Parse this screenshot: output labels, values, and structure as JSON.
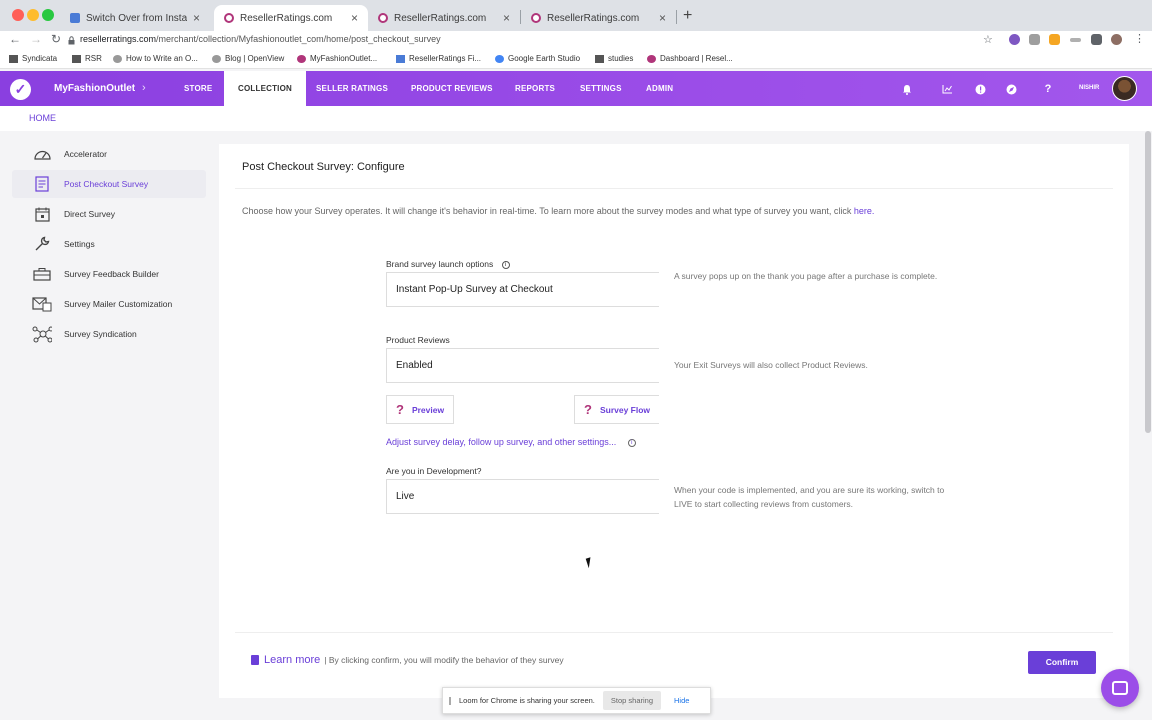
{
  "browser": {
    "tabs": [
      {
        "title": "Switch Over from Instant Surv..."
      },
      {
        "title": "ResellerRatings.com"
      },
      {
        "title": "ResellerRatings.com"
      },
      {
        "title": "ResellerRatings.com"
      }
    ],
    "url_host": "resellerratings.com",
    "url_path": "/merchant/collection/Myfashionoutlet_com/home/post_checkout_survey",
    "bookmarks": [
      "Syndicata",
      "RSR",
      "How to Write an O...",
      "Blog | OpenView",
      "MyFashionOutlet...",
      "ResellerRatings Fi...",
      "Google Earth Studio",
      "studies",
      "Dashboard | Resel..."
    ]
  },
  "header": {
    "brand": "MyFashionOutlet",
    "nav": [
      "STORE",
      "COLLECTION",
      "SELLER RATINGS",
      "PRODUCT REVIEWS",
      "REPORTS",
      "SETTINGS",
      "ADMIN"
    ],
    "user": "NISHIR"
  },
  "breadcrumb": "HOME",
  "sidebar": {
    "items": [
      {
        "label": "Accelerator",
        "icon": "gauge-icon"
      },
      {
        "label": "Post Checkout Survey",
        "icon": "document-icon"
      },
      {
        "label": "Direct Survey",
        "icon": "calendar-icon"
      },
      {
        "label": "Settings",
        "icon": "wrench-icon"
      },
      {
        "label": "Survey Feedback Builder",
        "icon": "toolbox-icon"
      },
      {
        "label": "Survey Mailer Customization",
        "icon": "mail-icon"
      },
      {
        "label": "Survey Syndication",
        "icon": "network-icon"
      }
    ]
  },
  "main": {
    "title": "Post Checkout Survey: Configure",
    "description": "Choose how your Survey operates. It will change it's behavior in real-time. To learn more about the survey modes and what type of survey you want, click",
    "description_link": "here.",
    "launch": {
      "label": "Brand survey launch options",
      "value": "Instant Pop-Up Survey at Checkout",
      "help": "A survey pops up on the thank you page after a purchase is complete."
    },
    "reviews": {
      "label": "Product Reviews",
      "value": "Enabled",
      "help": "Your Exit Surveys will also collect Product Reviews."
    },
    "preview_label": "Preview",
    "flow_label": "Survey Flow",
    "settings_link": "Adjust survey delay, follow up survey, and other settings...",
    "dev": {
      "label": "Are you in Development?",
      "value": "Live",
      "help": "When your code is implemented, and you are sure its working, switch to LIVE to start collecting reviews from customers."
    },
    "learn_more": "Learn more",
    "learn_note": "| By clicking confirm, you will modify the behavior of they survey",
    "confirm": "Confirm"
  },
  "share_bar": {
    "message": "Loom for Chrome is sharing your screen.",
    "stop": "Stop sharing",
    "hide": "Hide"
  },
  "colors": {
    "accent": "#6a3fd8",
    "header": "#9b4de8",
    "brand_pink": "#b0357a"
  }
}
